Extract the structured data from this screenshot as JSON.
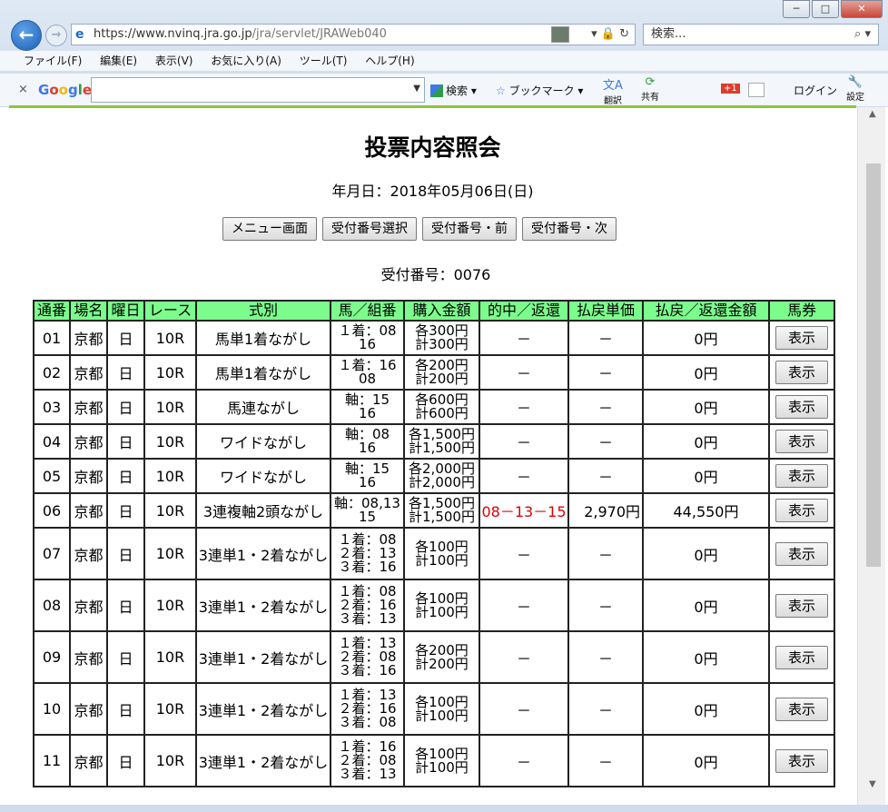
{
  "browser": {
    "url_host": "https://www.nvinq.jra.go.jp",
    "url_path": "/jra/servlet/JRAWeb040",
    "search_placeholder": "検索...",
    "window_buttons": [
      "─",
      "□",
      "✕"
    ],
    "menu": [
      "ファイル(F)",
      "編集(E)",
      "表示(V)",
      "お気に入り(A)",
      "ツール(T)",
      "ヘルプ(H)"
    ],
    "google_toolbar": {
      "close": "×",
      "logo": "Google",
      "search_label": "検索",
      "bookmark_label": "ブックマーク",
      "translate_label": "翻訳",
      "share_label": "共有",
      "login_label": "ログイン",
      "settings_label": "設定",
      "gplus": "+1"
    }
  },
  "page": {
    "title": "投票内容照会",
    "date_line": "年月日：2018年05月06日(日)",
    "buttons": [
      "メニュー画面",
      "受付番号選択",
      "受付番号・前",
      "受付番号・次"
    ],
    "receipt_line": "受付番号：0076"
  },
  "table": {
    "headers": [
      "通番",
      "場名",
      "曜日",
      "レース",
      "式別",
      "馬／組番",
      "購入金額",
      "的中／返還",
      "払戻単価",
      "払戻／返還金額",
      "馬券"
    ],
    "rows": [
      {
        "no": "01",
        "place": "京都",
        "day": "日",
        "race": "10R",
        "type": "馬単1着ながし",
        "bet1": "１着：08",
        "bet2": "16",
        "bet3": "",
        "amt1": "各300円",
        "amt2": "計300円",
        "hit": "－",
        "unit": "－",
        "payout": "0円",
        "btn": "表示"
      },
      {
        "no": "02",
        "place": "京都",
        "day": "日",
        "race": "10R",
        "type": "馬単1着ながし",
        "bet1": "１着：16",
        "bet2": "08",
        "bet3": "",
        "amt1": "各200円",
        "amt2": "計200円",
        "hit": "－",
        "unit": "－",
        "payout": "0円",
        "btn": "表示"
      },
      {
        "no": "03",
        "place": "京都",
        "day": "日",
        "race": "10R",
        "type": "馬連ながし",
        "bet1": "軸：15",
        "bet2": "16",
        "bet3": "",
        "amt1": "各600円",
        "amt2": "計600円",
        "hit": "－",
        "unit": "－",
        "payout": "0円",
        "btn": "表示"
      },
      {
        "no": "04",
        "place": "京都",
        "day": "日",
        "race": "10R",
        "type": "ワイドながし",
        "bet1": "軸：08",
        "bet2": "16",
        "bet3": "",
        "amt1": "各1,500円",
        "amt2": "計1,500円",
        "hit": "－",
        "unit": "－",
        "payout": "0円",
        "btn": "表示"
      },
      {
        "no": "05",
        "place": "京都",
        "day": "日",
        "race": "10R",
        "type": "ワイドながし",
        "bet1": "軸：15",
        "bet2": "16",
        "bet3": "",
        "amt1": "各2,000円",
        "amt2": "計2,000円",
        "hit": "－",
        "unit": "－",
        "payout": "0円",
        "btn": "表示"
      },
      {
        "no": "06",
        "place": "京都",
        "day": "日",
        "race": "10R",
        "type": "3連複軸2頭ながし",
        "bet1": "軸：08,13",
        "bet2": "15",
        "bet3": "",
        "amt1": "各1,500円",
        "amt2": "計1,500円",
        "hit": "08－13－15",
        "unit": "2,970円",
        "payout": "44,550円",
        "btn": "表示"
      },
      {
        "no": "07",
        "place": "京都",
        "day": "日",
        "race": "10R",
        "type": "3連単1・2着ながし",
        "bet1": "１着：08",
        "bet2": "２着：13",
        "bet3": "３着：16",
        "amt1": "各100円",
        "amt2": "計100円",
        "hit": "－",
        "unit": "－",
        "payout": "0円",
        "btn": "表示"
      },
      {
        "no": "08",
        "place": "京都",
        "day": "日",
        "race": "10R",
        "type": "3連単1・2着ながし",
        "bet1": "１着：08",
        "bet2": "２着：16",
        "bet3": "３着：13",
        "amt1": "各100円",
        "amt2": "計100円",
        "hit": "－",
        "unit": "－",
        "payout": "0円",
        "btn": "表示"
      },
      {
        "no": "09",
        "place": "京都",
        "day": "日",
        "race": "10R",
        "type": "3連単1・2着ながし",
        "bet1": "１着：13",
        "bet2": "２着：08",
        "bet3": "３着：16",
        "amt1": "各200円",
        "amt2": "計200円",
        "hit": "－",
        "unit": "－",
        "payout": "0円",
        "btn": "表示"
      },
      {
        "no": "10",
        "place": "京都",
        "day": "日",
        "race": "10R",
        "type": "3連単1・2着ながし",
        "bet1": "１着：13",
        "bet2": "２着：16",
        "bet3": "３着：08",
        "amt1": "各100円",
        "amt2": "計100円",
        "hit": "－",
        "unit": "－",
        "payout": "0円",
        "btn": "表示"
      },
      {
        "no": "11",
        "place": "京都",
        "day": "日",
        "race": "10R",
        "type": "3連単1・2着ながし",
        "bet1": "１着：16",
        "bet2": "２着：08",
        "bet3": "３着：13",
        "amt1": "各100円",
        "amt2": "計100円",
        "hit": "－",
        "unit": "－",
        "payout": "0円",
        "btn": "表示"
      }
    ]
  },
  "colors": {
    "header_bg": "#7cfc8c",
    "hit_text": "#e00000",
    "accent_line": "#8cc63f"
  }
}
